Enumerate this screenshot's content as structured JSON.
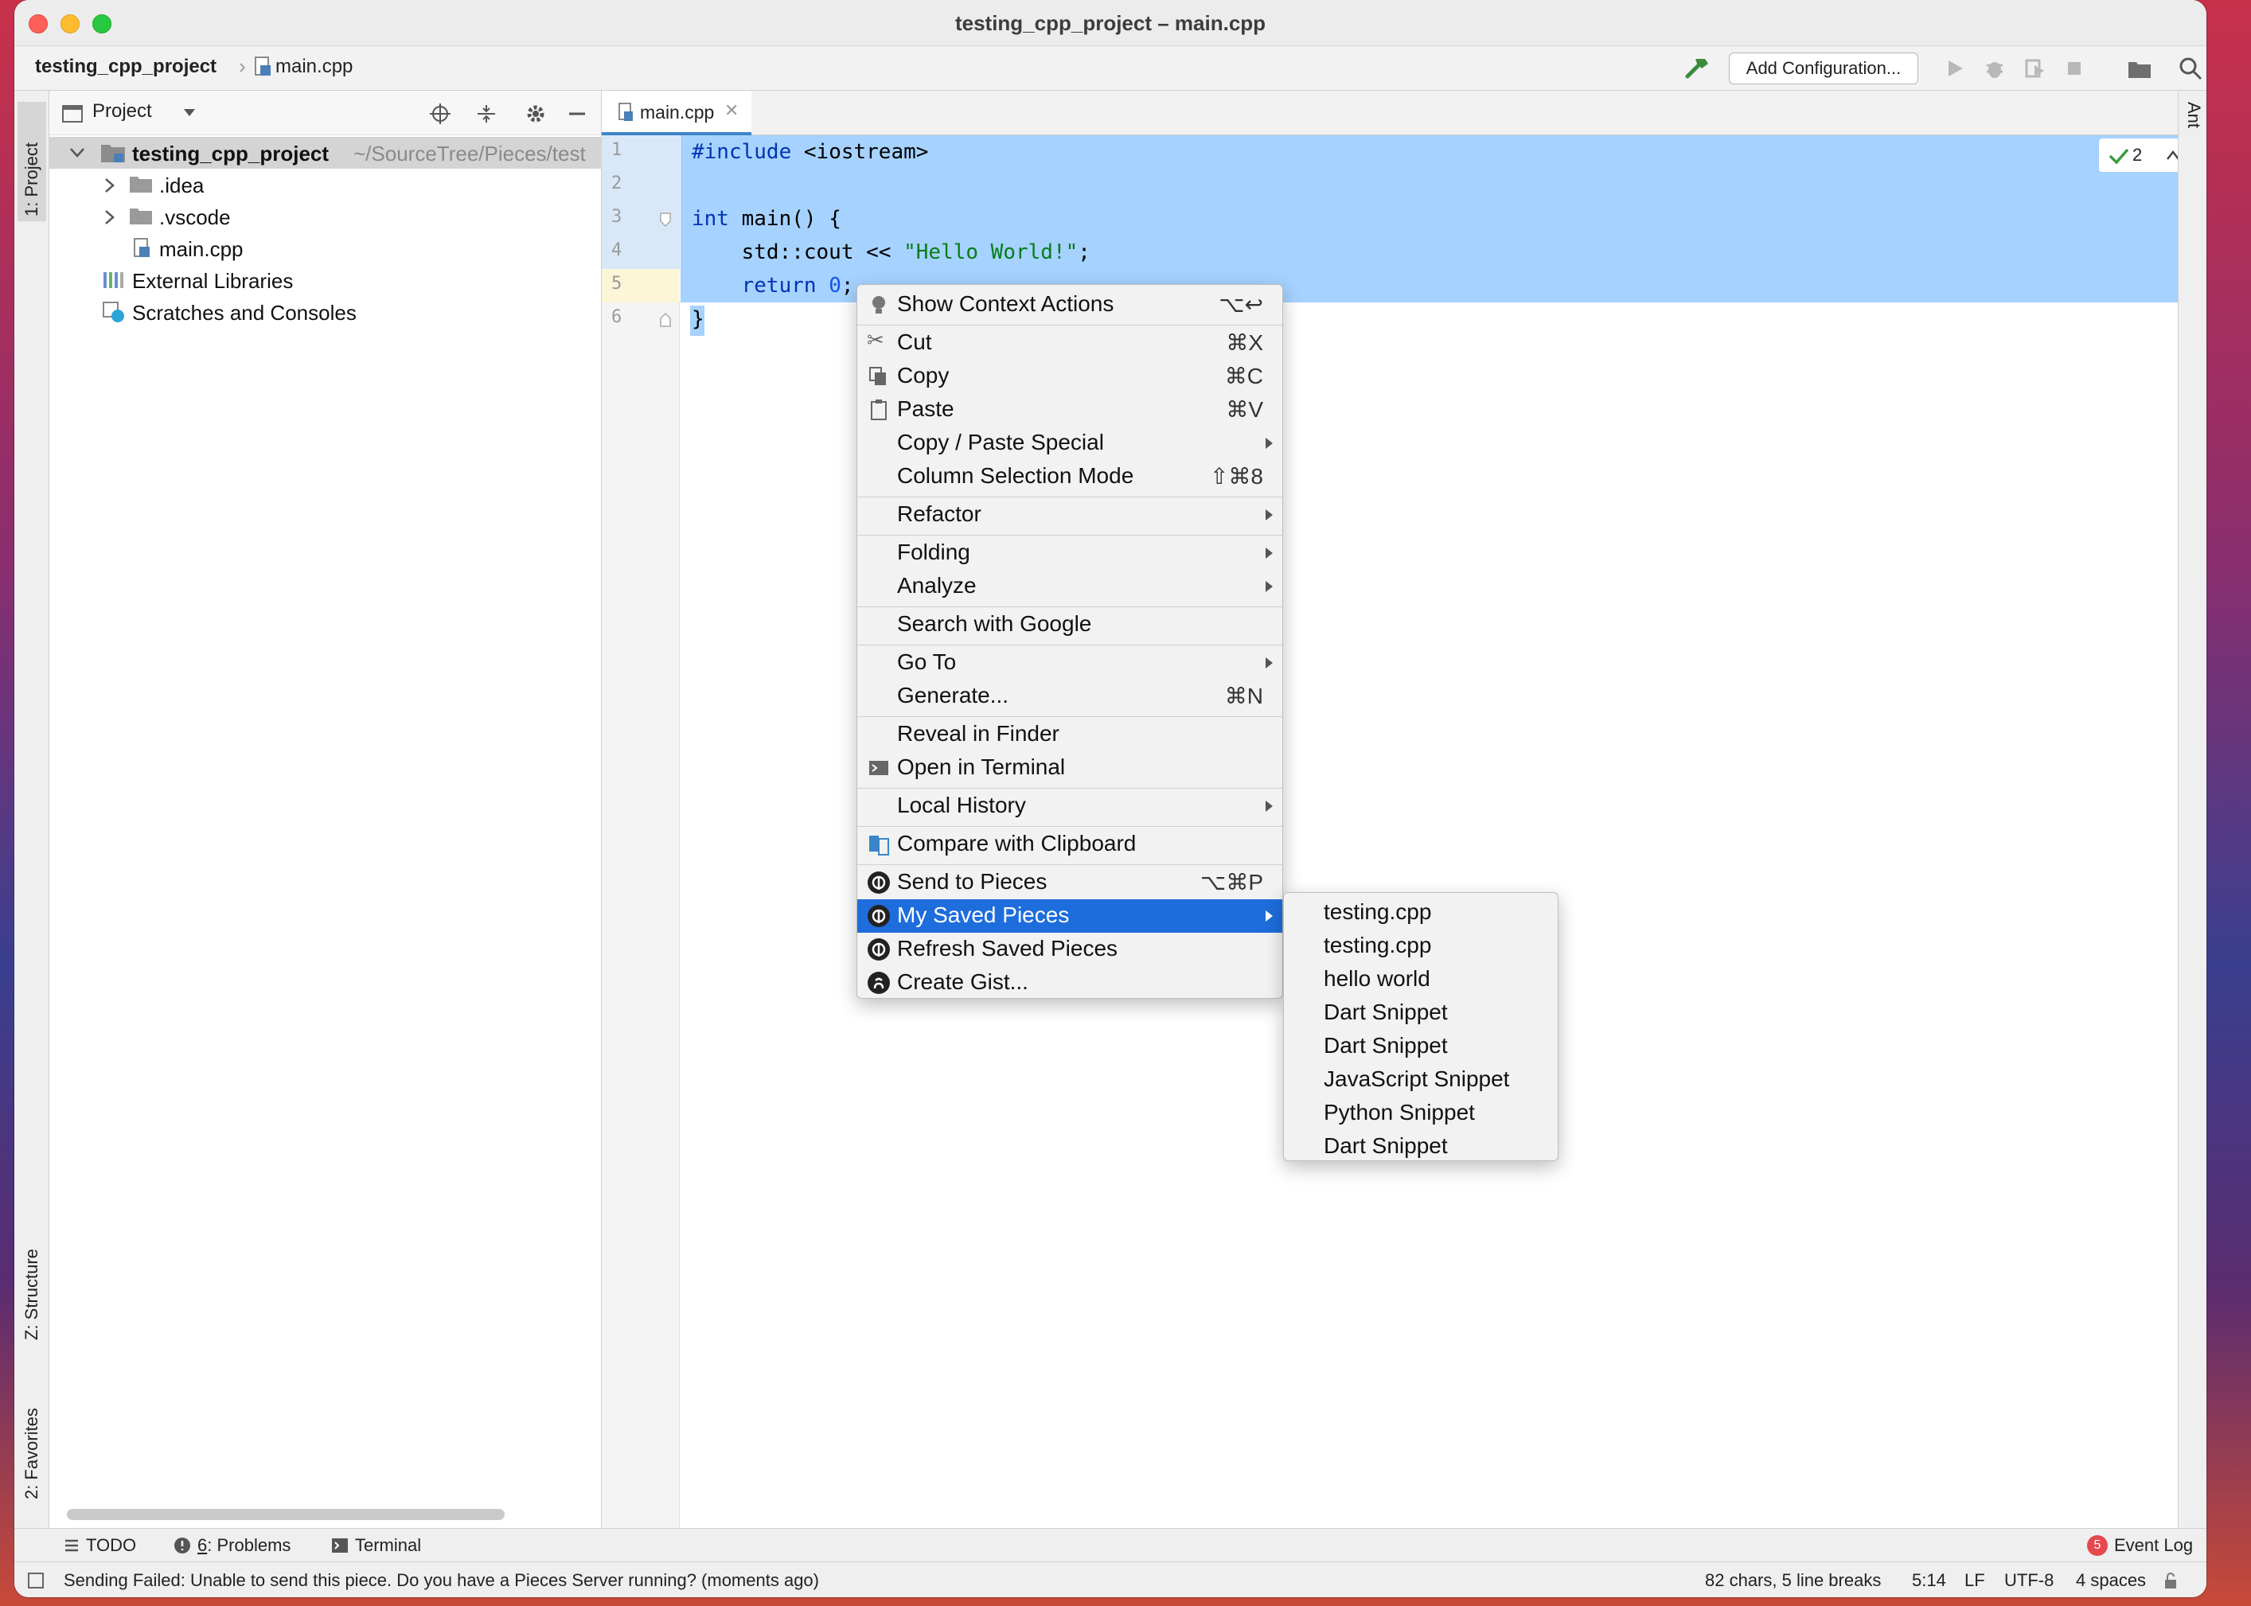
{
  "window": {
    "title": "testing_cpp_project – main.cpp"
  },
  "navbar": {
    "project": "testing_cpp_project",
    "file": "main.cpp",
    "add_configuration": "Add Configuration..."
  },
  "left_strip": {
    "project_tab": "1: Project",
    "structure_tab": "Z: Structure",
    "favorites_tab": "2: Favorites"
  },
  "right_strip": {
    "ant_tab": "Ant"
  },
  "project_pane": {
    "header": "Project",
    "root_name": "testing_cpp_project",
    "root_path": "~/SourceTree/Pieces/test",
    "items": [
      {
        "label": ".idea",
        "icon": "folder-icon"
      },
      {
        "label": ".vscode",
        "icon": "folder-icon"
      },
      {
        "label": "main.cpp",
        "icon": "cpp-file-icon"
      },
      {
        "label": "External Libraries",
        "icon": "library-icon"
      },
      {
        "label": "Scratches and Consoles",
        "icon": "scratch-icon"
      }
    ]
  },
  "editor": {
    "tab_label": "main.cpp",
    "line_numbers": [
      "1",
      "2",
      "3",
      "4",
      "5",
      "6"
    ],
    "inspection_count": "2",
    "code": {
      "l1_kw": "#include",
      "l1_rest": " <iostream>",
      "l3_kw": "int",
      "l3_rest": " main() {",
      "l4_pre": "    std::cout << ",
      "l4_str": "\"Hello World!\"",
      "l4_post": ";",
      "l5_kw": "    return ",
      "l5_num": "0",
      "l5_post": ";",
      "l6": "}"
    },
    "selection_color": "#a6d2ff"
  },
  "context_menu": {
    "items": [
      {
        "label": "Show Context Actions",
        "shortcut": "⌥↩",
        "icon": "lightbulb-icon"
      },
      {
        "label": "Cut",
        "shortcut": "⌘X",
        "icon": "scissors-icon"
      },
      {
        "label": "Copy",
        "shortcut": "⌘C",
        "icon": "copy-icon"
      },
      {
        "label": "Paste",
        "shortcut": "⌘V",
        "icon": "clipboard-icon"
      },
      {
        "label": "Copy / Paste Special",
        "shortcut": ""
      },
      {
        "label": "Column Selection Mode",
        "shortcut": "⇧⌘8"
      },
      {
        "label": "Refactor",
        "shortcut": ""
      },
      {
        "label": "Folding",
        "shortcut": ""
      },
      {
        "label": "Analyze",
        "shortcut": ""
      },
      {
        "label": "Search with Google",
        "shortcut": ""
      },
      {
        "label": "Go To",
        "shortcut": ""
      },
      {
        "label": "Generate...",
        "shortcut": "⌘N"
      },
      {
        "label": "Reveal in Finder",
        "shortcut": ""
      },
      {
        "label": "Open in Terminal",
        "shortcut": "",
        "icon": "terminal-icon"
      },
      {
        "label": "Local History",
        "shortcut": ""
      },
      {
        "label": "Compare with Clipboard",
        "shortcut": "",
        "icon": "compare-icon"
      },
      {
        "label": "Send to Pieces",
        "shortcut": "⌥⌘P",
        "icon": "pieces-icon"
      },
      {
        "label": "My Saved Pieces",
        "shortcut": "",
        "icon": "pieces-icon"
      },
      {
        "label": "Refresh Saved Pieces",
        "shortcut": "",
        "icon": "pieces-icon"
      },
      {
        "label": "Create Gist...",
        "shortcut": "",
        "icon": "github-icon"
      }
    ],
    "highlight_color": "#1d6ddc"
  },
  "submenu": {
    "items": [
      "testing.cpp",
      "testing.cpp",
      "hello world",
      "Dart Snippet",
      "Dart Snippet",
      "JavaScript Snippet",
      "Python Snippet",
      "Dart Snippet"
    ]
  },
  "tool_windows": {
    "todo": "TODO",
    "problems_num": "6",
    "problems": ": Problems",
    "terminal": "Terminal",
    "event_log_count": "5",
    "event_log": "Event Log"
  },
  "status_bar": {
    "message": "Sending Failed: Unable to send this piece. Do you have a Pieces Server running? (moments ago)",
    "selection_info": "82 chars, 5 line breaks",
    "position": "5:14",
    "line_separator": "LF",
    "encoding": "UTF-8",
    "indent": "4 spaces"
  }
}
